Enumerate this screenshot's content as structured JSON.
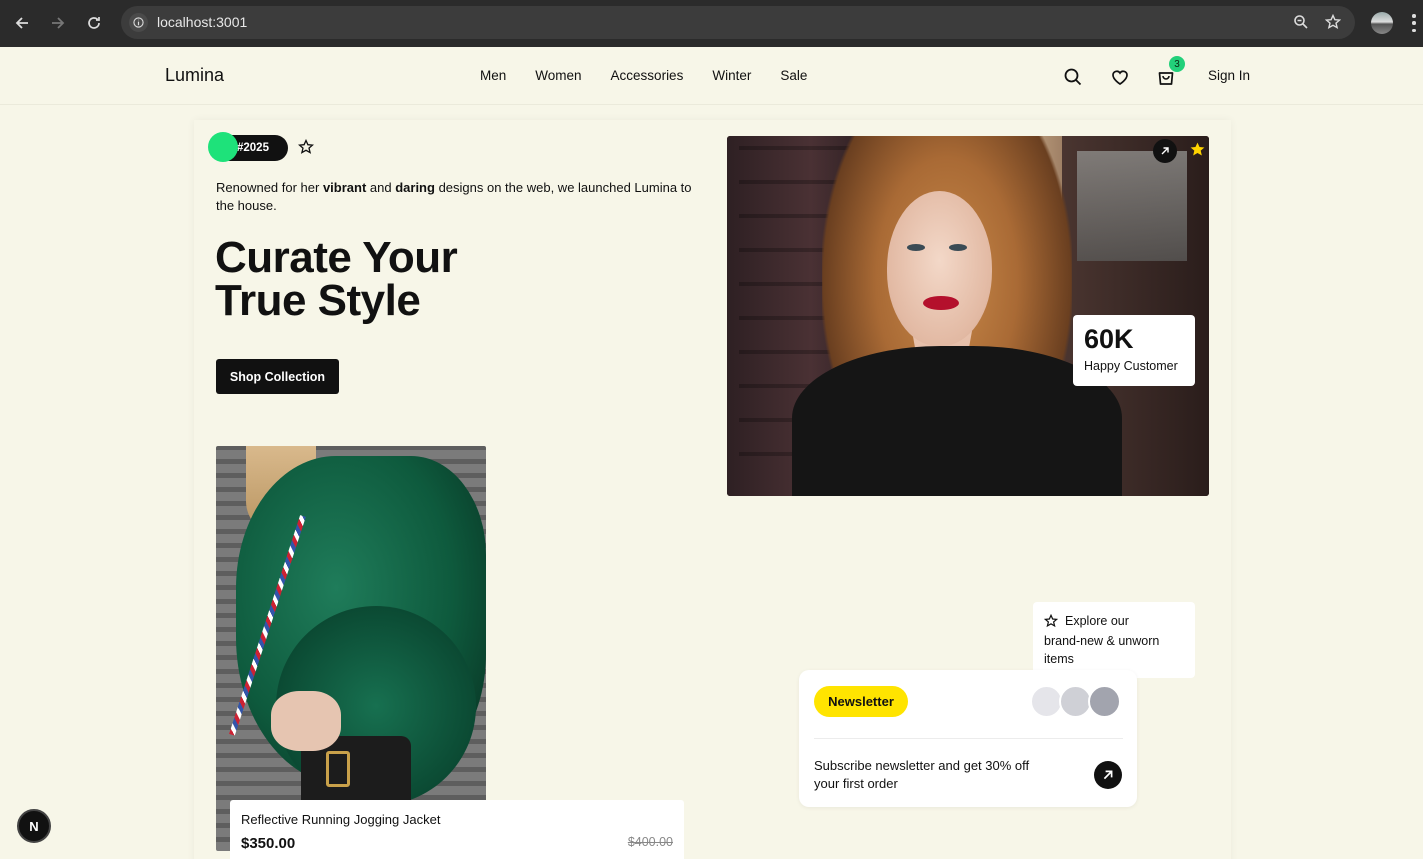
{
  "browser": {
    "url": "localhost:3001"
  },
  "header": {
    "logo": "Lumina",
    "nav": [
      "Men",
      "Women",
      "Accessories",
      "Winter",
      "Sale"
    ],
    "cart_count": "3",
    "signin": "Sign In"
  },
  "hero": {
    "tag": "#2025",
    "intro": {
      "p1": "Renowned for her ",
      "b1": "vibrant",
      "p2": " and ",
      "b2": "daring",
      "p3": " designs on the web, we launched Lumina to the house."
    },
    "headline_line1": "Curate Your",
    "headline_line2": "True Style",
    "cta": "Shop Collection",
    "stat_value": "60K",
    "stat_label": "Happy Customer"
  },
  "product": {
    "name": "Reflective Running Jogging Jacket",
    "price": "$350.00",
    "old_price": "$400.00"
  },
  "explore": {
    "line1": "Explore our",
    "line2": "brand-new & unworn items"
  },
  "newsletter": {
    "badge": "Newsletter",
    "text": "Subscribe newsletter and get 30% off your first order",
    "avatar_colors": [
      "#e5e5ea",
      "#cfd0d6",
      "#a2a4ae"
    ]
  },
  "dev_badge": "N",
  "colors": {
    "accent_green": "#1ee27a",
    "newsletter_yellow": "#ffe400",
    "background": "#f7f6e8"
  }
}
